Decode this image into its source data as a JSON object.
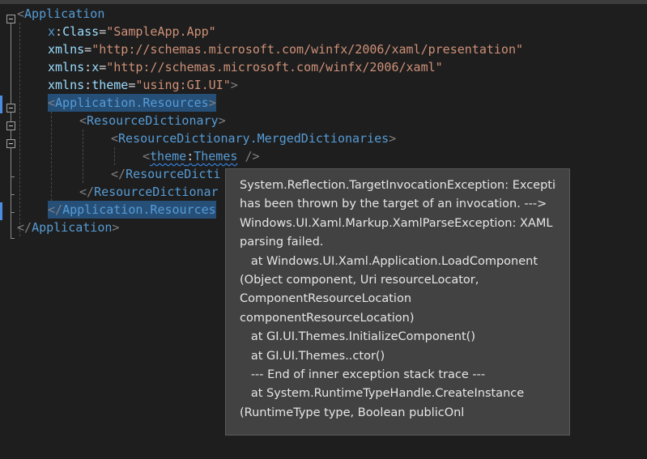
{
  "editor": {
    "lines": [
      {
        "tokens": [
          {
            "t": "<",
            "c": "bracket"
          },
          {
            "t": "Application",
            "c": "tag"
          }
        ]
      },
      {
        "tokens": [
          {
            "t": "x",
            "c": "prefix"
          },
          {
            "t": ":",
            "c": "colon"
          },
          {
            "t": "Class",
            "c": "attr"
          },
          {
            "t": "=",
            "c": "eq"
          },
          {
            "t": "\"SampleApp.App\"",
            "c": "string"
          }
        ]
      },
      {
        "tokens": [
          {
            "t": "xmlns",
            "c": "attr"
          },
          {
            "t": "=",
            "c": "eq"
          },
          {
            "t": "\"http://schemas.microsoft.com/winfx/2006/xaml/presentation\"",
            "c": "string"
          }
        ]
      },
      {
        "tokens": [
          {
            "t": "xmlns",
            "c": "attr"
          },
          {
            "t": ":",
            "c": "colon"
          },
          {
            "t": "x",
            "c": "attr"
          },
          {
            "t": "=",
            "c": "eq"
          },
          {
            "t": "\"http://schemas.microsoft.com/winfx/2006/xaml\"",
            "c": "string"
          }
        ]
      },
      {
        "tokens": [
          {
            "t": "xmlns",
            "c": "attr"
          },
          {
            "t": ":",
            "c": "colon"
          },
          {
            "t": "theme",
            "c": "attr"
          },
          {
            "t": "=",
            "c": "eq"
          },
          {
            "t": "\"using:GI.UI\"",
            "c": "string"
          },
          {
            "t": ">",
            "c": "bracket"
          }
        ]
      },
      {
        "tokens": [
          {
            "t": "<",
            "c": "bracket"
          },
          {
            "t": "Application.Resources",
            "c": "tag"
          },
          {
            "t": ">",
            "c": "bracket"
          }
        ]
      },
      {
        "tokens": [
          {
            "t": "<",
            "c": "bracket"
          },
          {
            "t": "ResourceDictionary",
            "c": "tag"
          },
          {
            "t": ">",
            "c": "bracket"
          }
        ]
      },
      {
        "tokens": [
          {
            "t": "<",
            "c": "bracket"
          },
          {
            "t": "ResourceDictionary.MergedDictionaries",
            "c": "tag"
          },
          {
            "t": ">",
            "c": "bracket"
          }
        ]
      },
      {
        "tokens": [
          {
            "t": "<",
            "c": "bracket"
          },
          {
            "t": "theme",
            "c": "prefix"
          },
          {
            "t": ":",
            "c": "colon"
          },
          {
            "t": "Themes",
            "c": "tag"
          },
          {
            "t": " ",
            "c": "space"
          },
          {
            "t": "/>",
            "c": "bracket"
          }
        ]
      },
      {
        "tokens": [
          {
            "t": "</",
            "c": "bracket"
          },
          {
            "t": "ResourceDicti",
            "c": "tag"
          }
        ]
      },
      {
        "tokens": [
          {
            "t": "</",
            "c": "bracket"
          },
          {
            "t": "ResourceDictionar",
            "c": "tag"
          }
        ]
      },
      {
        "tokens": [
          {
            "t": "</",
            "c": "bracket"
          },
          {
            "t": "Application.Resources",
            "c": "tag"
          }
        ]
      },
      {
        "tokens": [
          {
            "t": "</",
            "c": "bracket"
          },
          {
            "t": "Application",
            "c": "tag"
          },
          {
            "t": ">",
            "c": "bracket"
          }
        ]
      }
    ]
  },
  "tooltip": {
    "lines": [
      "System.Reflection.TargetInvocationException: Exception",
      "has been thrown by the target of an invocation. --->",
      "Windows.UI.Xaml.Markup.XamlParseException: XAML",
      "parsing failed.",
      "   at Windows.UI.Xaml.Application.LoadComponent",
      "(Object component, Uri resourceLocator,",
      "ComponentResourceLocation",
      "componentResourceLocation)",
      "   at GI.UI.Themes.InitializeComponent()",
      "   at GI.UI.Themes..ctor()",
      "   --- End of inner exception stack trace ---",
      "   at System.RuntimeTypeHandle.CreateInstance",
      "(RuntimeType type, Boolean publicOnl"
    ]
  },
  "colors": {
    "background": "#1e1e1e",
    "tag": "#569cd6",
    "attribute": "#9cdcfe",
    "string": "#ce9178",
    "bracket": "#808080",
    "selection": "#264f78",
    "tooltip_bg": "#424242",
    "change_bar": "#4b8de0"
  }
}
